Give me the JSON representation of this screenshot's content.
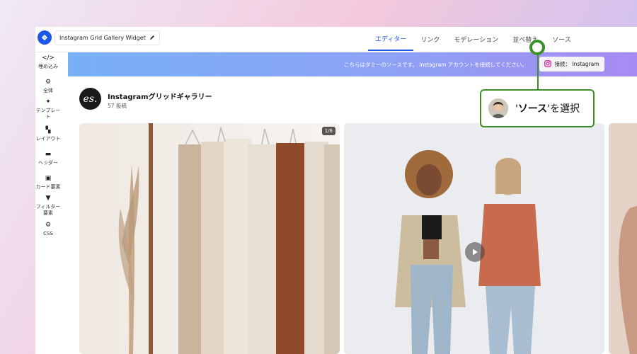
{
  "header": {
    "widget_name": "Instagram Grid Gallery Widget",
    "tabs": [
      {
        "label": "エディター",
        "active": true
      },
      {
        "label": "リンク"
      },
      {
        "label": "モデレーション"
      },
      {
        "label": "並べ替え"
      },
      {
        "label": "ソース"
      }
    ]
  },
  "sidebar": {
    "items": [
      {
        "icon": "code-icon",
        "label": "埋め込み"
      },
      {
        "icon": "gear-icon",
        "label": "全体"
      },
      {
        "icon": "sparkle-icon",
        "label": "テンプレート"
      },
      {
        "icon": "layout-icon",
        "label": "レイアウト"
      },
      {
        "icon": "header-icon",
        "label": "ヘッダー"
      },
      {
        "icon": "image-icon",
        "label": "カード要素"
      },
      {
        "icon": "filter-icon",
        "label": "フィルター要素"
      },
      {
        "icon": "gear-icon",
        "label": "CSS"
      }
    ]
  },
  "banner": {
    "text": "こちらはダミーのソースです。 Instagram アカウントを接続してください。",
    "connect_label": "接続： Instagram"
  },
  "profile": {
    "avatar_text": "es.",
    "name": "Instagramグリッドギャラリー",
    "posts": "57 投稿"
  },
  "gallery": {
    "card1_pager": "1/6"
  },
  "callout": {
    "prefix": "'",
    "bold": "ソース",
    "suffix": "'を選択"
  },
  "colors": {
    "accent": "#1d56e8",
    "callout_green": "#3d8f2a"
  }
}
